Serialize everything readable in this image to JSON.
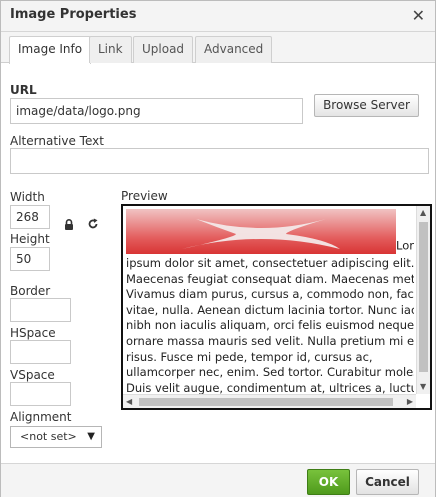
{
  "dialog": {
    "title": "Image Properties",
    "close_symbol": "✕"
  },
  "tabs": [
    {
      "label": "Image Info",
      "active": true
    },
    {
      "label": "Link",
      "active": false
    },
    {
      "label": "Upload",
      "active": false
    },
    {
      "label": "Advanced",
      "active": false
    }
  ],
  "url": {
    "label": "URL",
    "value": "image/data/logo.png",
    "browse_label": "Browse Server"
  },
  "alt_text": {
    "label": "Alternative Text",
    "value": ""
  },
  "width": {
    "label": "Width",
    "value": "268"
  },
  "height": {
    "label": "Height",
    "value": "50"
  },
  "border": {
    "label": "Border",
    "value": ""
  },
  "hspace": {
    "label": "HSpace",
    "value": ""
  },
  "vspace": {
    "label": "VSpace",
    "value": ""
  },
  "alignment": {
    "label": "Alignment",
    "selected": "<not set>"
  },
  "preview": {
    "label": "Preview",
    "lines": [
      "Lorem",
      "ipsum dolor sit amet, consectetuer adipiscing elit.",
      "Maecenas feugiat consequat diam. Maecenas metus.",
      "Vivamus diam purus, cursus a, commodo non, facilisis",
      "vitae, nulla. Aenean dictum lacinia tortor. Nunc iaculis,",
      "nibh non iaculis aliquam, orci felis euismod neque, sed",
      "ornare massa mauris sed velit. Nulla pretium mi et",
      "risus. Fusce mi pede, tempor id, cursus ac,",
      "ullamcorper nec, enim. Sed tortor. Curabitur molestie.",
      "Duis velit augue, condimentum at, ultrices a, luctus ut,"
    ]
  },
  "footer": {
    "ok_label": "OK",
    "cancel_label": "Cancel"
  },
  "colors": {
    "ok_green": "#5aab28",
    "logo_red": "#e04545"
  }
}
